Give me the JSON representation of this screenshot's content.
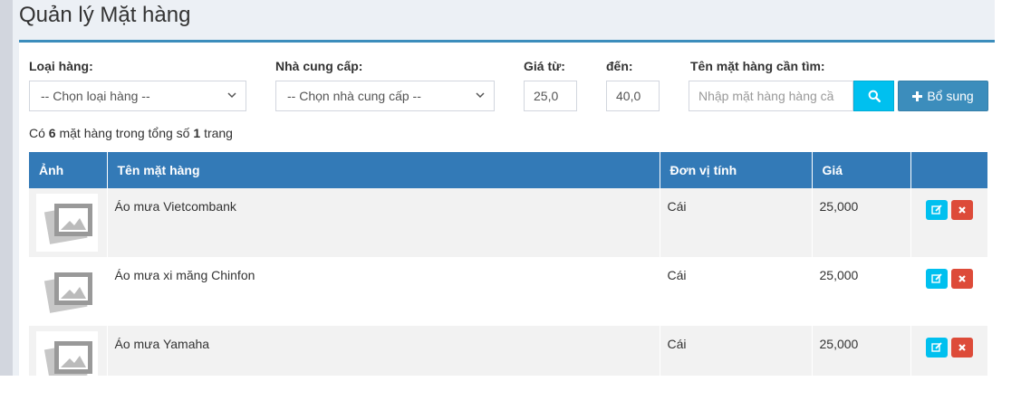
{
  "page": {
    "title": "Quản lý Mặt hàng"
  },
  "filters": {
    "category_label": "Loại hàng:",
    "category_value": "-- Chọn loại hàng --",
    "supplier_label": "Nhà cung cấp:",
    "supplier_value": "-- Chọn nhà cung cấp --",
    "price_from_label": "Giá từ:",
    "price_from_value": "25,0",
    "price_to_label": "đến:",
    "price_to_value": "40,0",
    "name_label": "Tên mặt hàng cần tìm:",
    "name_placeholder": "Nhập mặt hàng hàng cầ",
    "add_label": "Bổ sung"
  },
  "summary": {
    "prefix": "Có",
    "count": "6",
    "middle": "mặt hàng trong tổng số",
    "pages": "1",
    "suffix": "trang"
  },
  "table": {
    "headers": [
      "Ảnh",
      "Tên mặt hàng",
      "Đơn vị tính",
      "Giá",
      ""
    ],
    "rows": [
      {
        "name": "Áo mưa Vietcombank",
        "unit": "Cái",
        "price": "25,000"
      },
      {
        "name": "Áo mưa xi măng Chinfon",
        "unit": "Cái",
        "price": "25,000"
      },
      {
        "name": "Áo mưa Yamaha",
        "unit": "Cái",
        "price": "25,000"
      }
    ]
  },
  "icons": {
    "search": "search-icon",
    "add": "plus-icon",
    "edit": "edit-icon",
    "delete": "close-icon",
    "thumbnail": "image-placeholder-icon",
    "dropdown": "chevron-down-icon"
  },
  "colors": {
    "primary": "#3c8dbc",
    "header": "#337ab7",
    "info": "#00c0ef",
    "danger": "#dd4b39",
    "content_bg": "#ecf0f5"
  }
}
